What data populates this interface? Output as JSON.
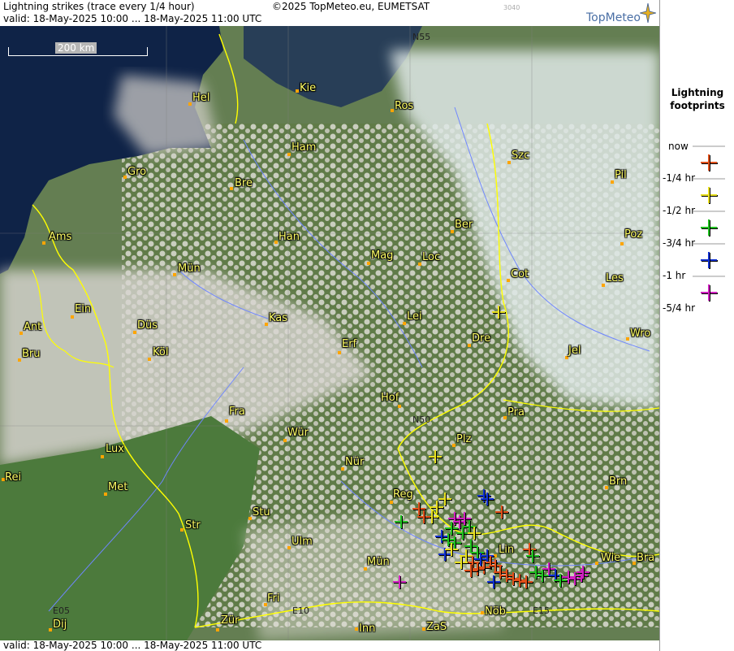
{
  "header": {
    "title": "Lightning strikes (trace every 1/4 hour)",
    "valid": "valid:  18-May-2025 10:00 ... 18-May-2025 11:00 UTC",
    "copyright": "©2025 TopMeteo.eu, EUMETSAT",
    "code": "3040",
    "logo": "TopMeteo"
  },
  "footer": {
    "valid": "valid:  18-May-2025 10:00 ... 18-May-2025 11:00 UTC"
  },
  "scale_label": "200 km",
  "grid_labels": {
    "n55": "N55",
    "n50": "N50",
    "e05": "E05",
    "e10": "E10",
    "e15": "E15"
  },
  "cities": [
    "Kie",
    "Hel",
    "Ros",
    "Ham",
    "Gro",
    "Szc",
    "Bre",
    "Pil",
    "Ber",
    "Ams",
    "Han",
    "Poz",
    "Mag",
    "Loc",
    "Mün",
    "Cot",
    "Les",
    "Ein",
    "Lei",
    "Ant",
    "Düs",
    "Kas",
    "Dre",
    "Wro",
    "Bru",
    "Köl",
    "Erf",
    "Jel",
    "Hof",
    "Fra",
    "Pra",
    "Würz",
    "Plz",
    "Lux",
    "Nür",
    "Rei",
    "Met",
    "Reg",
    "Brn",
    "Stu",
    "Str",
    "Ulm",
    "Lin",
    "Wie",
    "Bra",
    "Mün2",
    "Fri",
    "Dij",
    "Zür",
    "Inn",
    "ZaS",
    "Nöb"
  ],
  "city_names": {
    "kie": "Kie",
    "hel": "Hel",
    "ros": "Ros",
    "ham": "Ham",
    "gro": "Gro",
    "szc": "Szc",
    "bre": "Bre",
    "pil": "Pil",
    "ber": "Ber",
    "ams": "Ams",
    "han": "Han",
    "poz": "Poz",
    "mag": "Mag",
    "loc": "Loc",
    "mun1": "Mün",
    "cot": "Cot",
    "les": "Les",
    "ein": "Ein",
    "lei": "Lei",
    "ant": "Ant",
    "dus": "Düs",
    "kas": "Kas",
    "dre": "Dre",
    "wro": "Wro",
    "bru": "Bru",
    "kol": "Köl",
    "erf": "Erf",
    "jel": "Jel",
    "hof": "Hof",
    "fra": "Fra",
    "pra": "Pra",
    "wur": "Wür",
    "plz": "Plz",
    "lux": "Lux",
    "nur": "Nür",
    "rei": "Rei",
    "met": "Met",
    "reg": "Reg",
    "brn": "Brn",
    "stu": "Stu",
    "str": "Str",
    "ulm": "Ulm",
    "lin": "Lin",
    "wie": "Wie",
    "bra": "Bra",
    "mun2": "Mün",
    "fri": "Fri",
    "dij": "Dij",
    "zur": "Zür",
    "inn": "Inn",
    "zas": "ZaS",
    "nob": "Nöb"
  },
  "legend": {
    "title_line1": "Lightning",
    "title_line2": "footprints",
    "items": [
      {
        "label": "now",
        "color": "#e0501a"
      },
      {
        "label": "-1/4 hr",
        "color": "#e8e020"
      },
      {
        "label": "-1/2 hr",
        "color": "#20c020"
      },
      {
        "label": "-3/4 hr",
        "color": "#1030d0"
      },
      {
        "label": "-1 hr",
        "color": "#d020c0"
      },
      {
        "label": "-5/4 hr",
        "color": ""
      }
    ]
  },
  "colors": {
    "sea": "#0f2347",
    "land": "#4d6b3a",
    "cloud": "#e6e4e0",
    "border": "#ffff00",
    "river": "#6f86ff",
    "city": "#ffff66"
  }
}
